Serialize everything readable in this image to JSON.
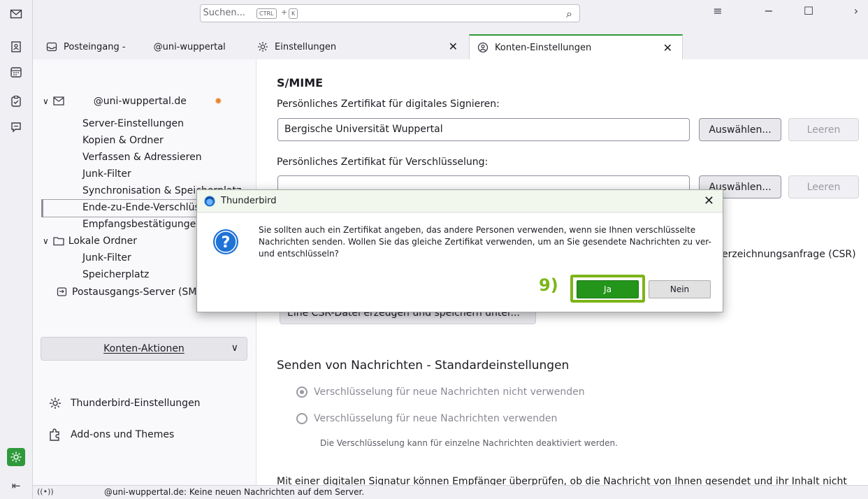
{
  "titlebar": {
    "search_placeholder": "Suchen...",
    "kbd_ctrl": "CTRL",
    "kbd_plus": "+",
    "kbd_k": "K"
  },
  "tabs": [
    {
      "label": "Posteingang -",
      "account": "@uni-wuppertal"
    },
    {
      "label": "Einstellungen"
    },
    {
      "label": "Konten-Einstellungen"
    }
  ],
  "sidebar": {
    "account": "@uni-wuppertal.de",
    "items": [
      "Server-Einstellungen",
      "Kopien & Ordner",
      "Verfassen & Adressieren",
      "Junk-Filter",
      "Synchronisation & Speicherplatz",
      "Ende-zu-Ende-Verschlüsselung",
      "Empfangsbestätigungen"
    ],
    "local_folders": "Lokale Ordner",
    "local_items": [
      "Junk-Filter",
      "Speicherplatz"
    ],
    "outgoing": "Postausgangs-Server (SMTP)",
    "account_actions": "Konten-Aktionen",
    "tb_settings": "Thunderbird-Einstellungen",
    "addons": "Add-ons und Themes"
  },
  "main": {
    "smime_heading": "S/MIME",
    "sign_label": "Persönliches Zertifikat für digitales Signieren:",
    "sign_value": "Bergische Universität Wuppertal",
    "select_btn": "Auswählen...",
    "clear_btn": "Leeren",
    "encrypt_label": "Persönliches Zertifikat für Verschlüsselung:",
    "csr_text": "erzeichnungsanfrage (CSR)",
    "csr_button": "Eine CSR-Datei erzeugen und speichern unter...",
    "send_heading": "Senden von Nachrichten - Standardeinstellungen",
    "radio1": "Verschlüsselung für neue Nachrichten nicht verwenden",
    "radio2": "Verschlüsselung für neue Nachrichten verwenden",
    "note": "Die Verschlüsselung kann für einzelne Nachrichten deaktiviert werden.",
    "signature_text": "Mit einer digitalen Signatur können Empfänger überprüfen, ob die Nachricht von Ihnen gesendet und ihr Inhalt nicht"
  },
  "status": {
    "text": "@uni-wuppertal.de: Keine neuen Nachrichten auf dem Server."
  },
  "dialog": {
    "title": "Thunderbird",
    "message": "Sie sollten auch ein Zertifikat angeben, das andere Personen verwenden, wenn sie Ihnen verschlüsselte Nachrichten senden. Wollen Sie das gleiche Zertifikat verwenden, um an Sie gesendete Nachrichten zu ver- und entschlüsseln?",
    "step": "9)",
    "yes": "Ja",
    "no": "Nein"
  },
  "colors": {
    "accent_green": "#2f9a3c",
    "step_highlight": "#7cb518",
    "ja_button": "#23951a"
  }
}
